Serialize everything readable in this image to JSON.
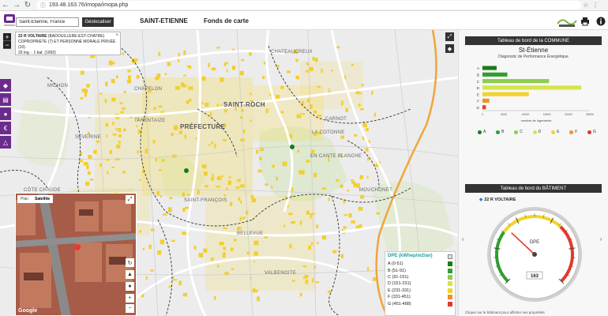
{
  "browser": {
    "url": "193.48.163.76/imopa/imopa.php"
  },
  "header": {
    "search_value": "Saint-Étienne, France",
    "geolocate_label": "Géolocaliser",
    "city_title": "SAINT-ETIENNE",
    "basemap_label": "Fonds de carte",
    "metro_logo_text": "Saint-Étienne métropole"
  },
  "popup": {
    "title": "22 R VOLTAIRE",
    "line1_rest": "(BADOUILLERE-EST-CHATRE)",
    "line2": "COPROPRIETE (7) ET PERSONNE MORALE PRIVEE (10)",
    "line3": "33 log. - 1 bat. (1992)"
  },
  "map_labels": [
    {
      "text": "CHATEAUCREUX"
    },
    {
      "text": "SAINT-ROCH"
    },
    {
      "text": "CHAPELON"
    },
    {
      "text": "TARENTAIZE"
    },
    {
      "text": "PRÉFECTURE"
    },
    {
      "text": "SÉVERINE"
    },
    {
      "text": "LA COTONNE"
    },
    {
      "text": "EN CANTE BLANCHE"
    },
    {
      "text": "MOUCHONET"
    },
    {
      "text": "CARNOT"
    },
    {
      "text": "BELLEVUE"
    },
    {
      "text": "VALBENOITE"
    },
    {
      "text": "SAINT-FRANÇOIS"
    },
    {
      "text": "CÔTE CHAUDE"
    },
    {
      "text": "MICHON"
    }
  ],
  "street_view": {
    "tab_plan": "Plan",
    "tab_satellite": "Satellite",
    "brand": "Google"
  },
  "legend": {
    "title": "DPE (kWhep/m2/an)",
    "classes": [
      {
        "label": "A (0-51)",
        "color": "#1a7a1a"
      },
      {
        "label": "B (51-91)",
        "color": "#2f9f2f"
      },
      {
        "label": "C (91-151)",
        "color": "#8fcc4d"
      },
      {
        "label": "D (151-231)",
        "color": "#d6e44a"
      },
      {
        "label": "E (231-331)",
        "color": "#f2d32b"
      },
      {
        "label": "F (331-451)",
        "color": "#f0912a"
      },
      {
        "label": "G (451-488)",
        "color": "#e23a2a"
      }
    ]
  },
  "right_panel": {
    "commune_header": "Tableau de bord de la COMMUNE",
    "commune_name": "St-Étienne",
    "commune_subtitle": "Diagnostic de Performance Énergétique",
    "batiment_header": "Tableau de bord du BÂTIMENT",
    "batiment_title": "22 R VOLTAIRE",
    "gauge_label": "DPE",
    "gauge_value_text": "163",
    "note": "Cliquer sur le bâtiment pour afficher ses propriétés"
  },
  "chart_data": {
    "type": "bar",
    "orientation": "horizontal",
    "title": "",
    "categories": [
      "A",
      "B",
      "C",
      "D",
      "E",
      "F",
      "G"
    ],
    "values": [
      3300,
      5800,
      15500,
      23000,
      10800,
      1600,
      800
    ],
    "colors": [
      "#1a7a1a",
      "#2f9f2f",
      "#8fcc4d",
      "#d6e44a",
      "#f2d32b",
      "#f0912a",
      "#e23a2a"
    ],
    "xlabel": "nombre de logements",
    "ylabel": "",
    "xlim": [
      0,
      25000
    ],
    "xticks": [
      0,
      5000,
      10000,
      15000,
      20000,
      25000
    ],
    "grid": false,
    "legend": "bottom"
  },
  "gauge": {
    "value": 163,
    "min": 0,
    "max": 500
  },
  "colors": {
    "header_dark": "#333333",
    "side_tools": "#6b2b8c",
    "legend_title": "#1aa29b",
    "map_building": "#f4d94a"
  }
}
